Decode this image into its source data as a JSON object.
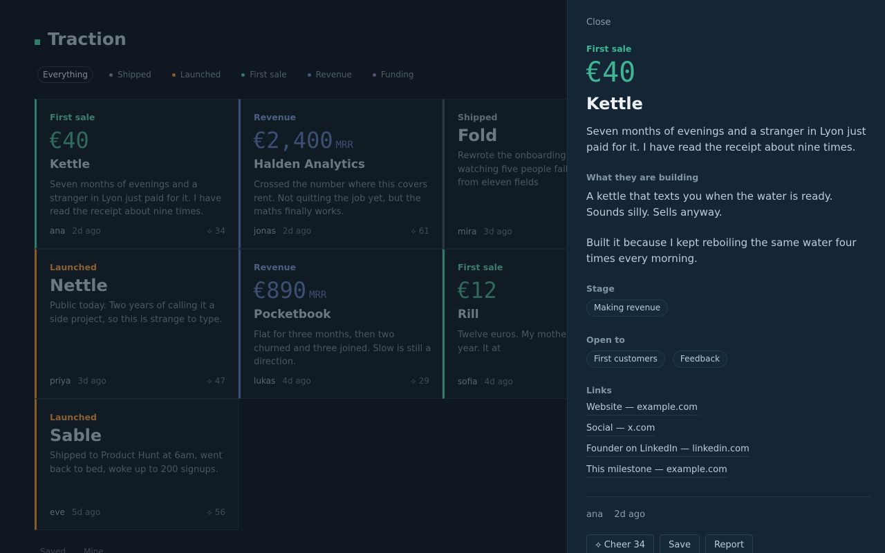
{
  "header": {
    "title": "Traction"
  },
  "filters": [
    {
      "label": "Everything",
      "color": ""
    },
    {
      "label": "Shipped",
      "color": "#4f5d68"
    },
    {
      "label": "Launched",
      "color": "#8a5a2a"
    },
    {
      "label": "First sale",
      "color": "#2f7d6a"
    },
    {
      "label": "Revenue",
      "color": "#3f5480"
    },
    {
      "label": "Funding",
      "color": "#5a4f78"
    }
  ],
  "cards": [
    {
      "kind": "First sale",
      "amount": "€40",
      "unit": "",
      "name": "Kettle",
      "desc": "Seven months of evenings and a stranger in Lyon just paid for it. I have read the receipt about nine times.",
      "author": "ana",
      "ago": "2d ago",
      "cheers": "⟡ 34"
    },
    {
      "kind": "Revenue",
      "amount": "€2,400",
      "unit": "MRR",
      "name": "Halden Analytics",
      "desc": "Crossed the number where this covers rent. Not quitting the job yet, but the maths finally works.",
      "author": "jonas",
      "ago": "2d ago",
      "cheers": "⟡ 61"
    },
    {
      "kind": "Shipped",
      "amount": "",
      "unit": "",
      "name": "Fold",
      "desc": "Rewrote the onboarding after watching five people fail at it. Down from eleven fields",
      "author": "mira",
      "ago": "3d ago",
      "cheers": ""
    },
    {
      "kind": "Launched",
      "amount": "",
      "unit": "",
      "name": "Nettle",
      "desc": "Public today. Two years of calling it a side project, so this is strange to type.",
      "author": "priya",
      "ago": "3d ago",
      "cheers": "⟡ 47"
    },
    {
      "kind": "Revenue",
      "amount": "€890",
      "unit": "MRR",
      "name": "Pocketbook",
      "desc": "Flat for three months, then two churned and three joined. Slow is still a direction.",
      "author": "lukas",
      "ago": "4d ago",
      "cheers": "⟡ 29"
    },
    {
      "kind": "First sale",
      "amount": "€12",
      "unit": "",
      "name": "Rill",
      "desc": "Twelve euros. My mother was worth the year. It at",
      "author": "sofia",
      "ago": "4d ago",
      "cheers": ""
    },
    {
      "kind": "Launched",
      "amount": "",
      "unit": "",
      "name": "Sable",
      "desc": "Shipped to Product Hunt at 6am, went back to bed, woke up to 200 signups.",
      "author": "eve",
      "ago": "5d ago",
      "cheers": "⟡ 56"
    }
  ],
  "bottom_tabs": [
    "Saved",
    "Mine"
  ],
  "panel": {
    "close_label": "Close",
    "kind": "First sale",
    "amount": "€40",
    "name": "Kettle",
    "story": "Seven months of evenings and a stranger in Lyon just paid for it. I have read the receipt about nine times.",
    "building_heading": "What they are building",
    "building_p1": "A kettle that texts you when the water is ready. Sounds silly. Sells anyway.",
    "building_p2": "Built it because I kept reboiling the same water four times every morning.",
    "stage_heading": "Stage",
    "stage": "Making revenue",
    "open_heading": "Open to",
    "open_to": [
      "First customers",
      "Feedback"
    ],
    "links_heading": "Links",
    "links": [
      "Website — example.com",
      "Social — x.com",
      "Founder on LinkedIn — linkedin.com",
      "This milestone — example.com"
    ],
    "author": "ana",
    "ago": "2d ago",
    "cheer_label": "⟡ Cheer 34",
    "save_label": "Save",
    "report_label": "Report"
  },
  "colors": {
    "first_sale": "#2f7d6a",
    "first_sale_label": "#3c7d6c",
    "revenue": "#3a4e78",
    "revenue_label": "#4d5f84",
    "shipped": "#2b3945",
    "shipped_label": "#5c6873",
    "launched": "#8a5a2a",
    "launched_label": "#8a6033"
  }
}
